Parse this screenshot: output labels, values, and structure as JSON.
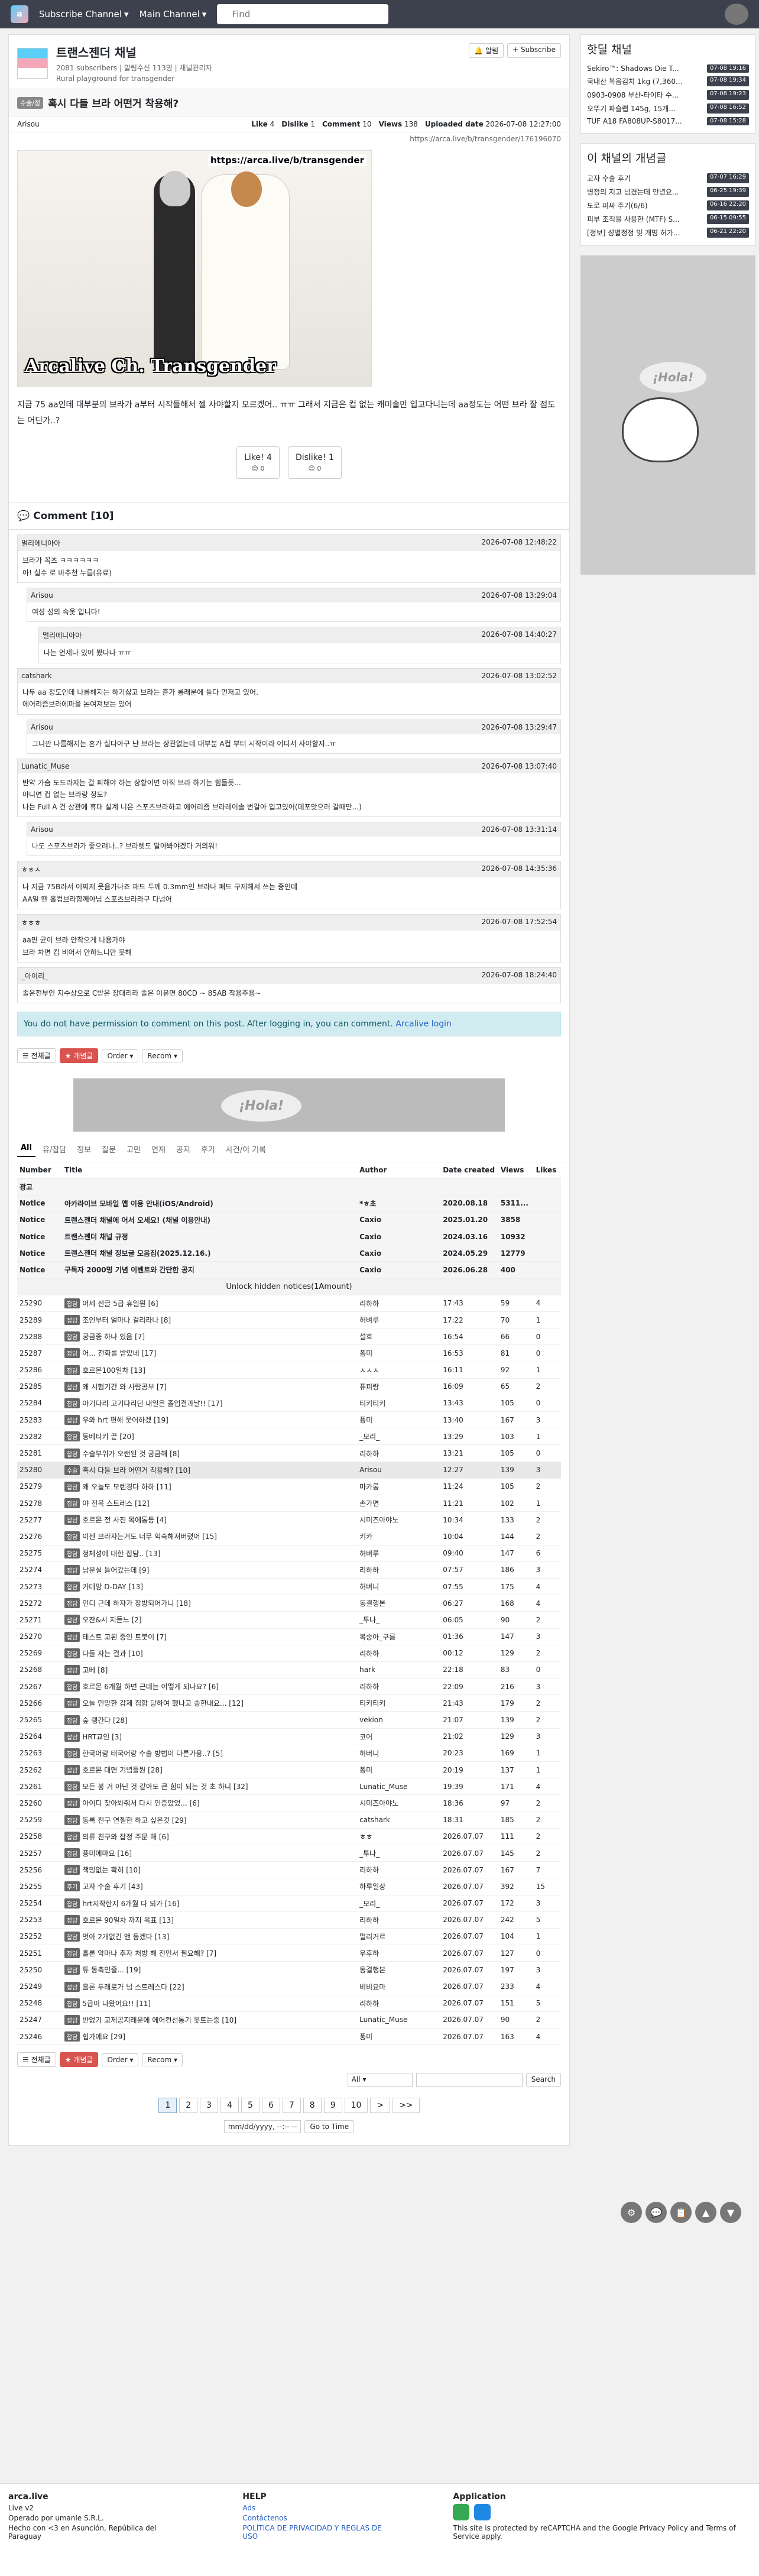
{
  "nav": {
    "subscribe_label": "Subscribe Channel",
    "main_label": "Main Channel",
    "search_placeholder": "Find"
  },
  "board": {
    "title": "트랜스젠더 채널",
    "subscribers": "2081 subscribers",
    "meta_extra": "알림수신 113명",
    "manager": "| 채널관리자",
    "desc": "Rural playground for transgender",
    "notify_label": "알림",
    "subscribe_label": "+ Subscribe"
  },
  "article": {
    "category": "수술/정",
    "title": "혹시 다들 브라 어떤거 착용해?",
    "author": "Arisou",
    "like_label": "Like",
    "like_count": "4",
    "dislike_label": "Dislike",
    "dislike_count": "1",
    "comment_label": "Comment",
    "comment_count": "10",
    "views_label": "Views",
    "views_count": "138",
    "uploaded_label": "Uploaded date",
    "uploaded_date": "2026-07-08 12:27:00",
    "link": "https://arca.live/b/transgender/176196070",
    "image_tag": "https://arca.live/b/transgender",
    "image_caption": "Arcalive Ch. Transgender",
    "body": "지금 75 aa인데 대부분의 브라가 a부터 시작들해서 젤 사야할지 모르겠어.. ㅠㅠ 그래서 지금은 컵 없는 캐미솔만 입고다니는데 aa정도는 어떤 브라 잘 점도는 어딘가..?",
    "vote_like": "Like! 4",
    "vote_like_sub": "😊 0",
    "vote_dislike": "Dislike! 1",
    "vote_dislike_sub": "😊 0"
  },
  "comments_section": {
    "title": "Comment [10]",
    "items": [
      {
        "author": "멀리에니아아",
        "date": "2026-07-08 12:48:22",
        "body": "브라가 꼭츠 ㅋㅋㅋㅋㅋㅋ\n아! 실수 로 바추천 누름(유료)"
      },
      {
        "author": "Arisou",
        "date": "2026-07-08 13:29:04",
        "body": "여성 성의 속옷 입니다!"
      },
      {
        "author": "멀리에니아아",
        "date": "2026-07-08 14:40:27",
        "body": "나는 언제나 있어 봤다나 ㅠㅠ"
      },
      {
        "author": "catshark",
        "date": "2026-07-08 13:02:52",
        "body": "나두 aa 정도인데 나름해지는 하기싫고 브라는 흔가 롱래분에 들다 먼저고 있어.\n에어리즘브라에파을 논여져보는 있어"
      },
      {
        "author": "Arisou",
        "date": "2026-07-08 13:29:47",
        "body": "그니깐 나름해지는 흔가 실다아구 난 브라는 상관없는데 대부분 A컵 부터 시작이라 어디서 사야할지..ㅠ"
      },
      {
        "author": "Lunatic_Muse",
        "date": "2026-07-08 13:07:40",
        "body": "반약 가슴 도드라지는 걸 피해야 하는 상황이면 아직 브라 하기는 힘들듯...\n아니면 컵 없는 브라랑 정도?\n나는 Full A 건 상관에 휴대 설계 니은 스포츠브라하고 에어리즘 브라레이솔 번갈아 입고있어(데포앗으러 갈때만...)"
      },
      {
        "author": "Arisou",
        "date": "2026-07-08 13:31:14",
        "body": "나도 스포츠브라가 좋으려나..? 브라렛도 알아봐야겠다 거의워!"
      },
      {
        "author": "ㅎㅎㅅ",
        "date": "2026-07-08 14:35:36",
        "body": "나 지금 75B라서 어찌저 웃음가나죠 패드 두께 0.3mm인 브라나 패드 구제해서 쓰는 중인데\nAA일 땐 홀컵브라함께아님 스포츠브라라구 다넘어"
      },
      {
        "author": "ㅎㅎㅎ",
        "date": "2026-07-08 17:52:54",
        "body": "aa면 균이 브라 안착으게 나용가야\n브라 차면 컵 비어서 안하느니만 못해"
      },
      {
        "author": "_아이리_",
        "date": "2026-07-08 18:24:40",
        "body": "졸은전부인 지수상으로 C받은 장대리라 졸은 이유면 80CD ~ 85AB 착용주용~"
      }
    ]
  },
  "no_permission": "You do not have permission to comment on this post. After logging in, you can comment.",
  "login_link": "Arcalive login",
  "tools": {
    "all_label": "전체글",
    "best_label": "개념글",
    "order_label": "Order",
    "recom_label": "Recom"
  },
  "ad_text": "¡Hola!",
  "categories": [
    "All",
    "유/잡담",
    "정보",
    "질문",
    "고민",
    "연재",
    "공지",
    "후기",
    "사건/이 기록"
  ],
  "table": {
    "headers": {
      "number": "Number",
      "title": "Title",
      "author": "Author",
      "date": "Date created",
      "views": "Views",
      "likes": "Likes"
    },
    "ad_row": "광고",
    "notices": [
      {
        "no": "Notice",
        "title": "아카라이브 모바일 앱 이용 안내(iOS/Android)",
        "author": "*ㅎ초",
        "date": "2020.08.18",
        "views": "5311...",
        "likes": ""
      },
      {
        "no": "Notice",
        "title": "트랜스젠더 채널에 어서 오세요! (채널 이용안내)",
        "author": "Caxio",
        "date": "2025.01.20",
        "views": "3858",
        "likes": ""
      },
      {
        "no": "Notice",
        "title": "트랜스젠더 채널 규정",
        "author": "Caxio",
        "date": "2024.03.16",
        "views": "10932",
        "likes": ""
      },
      {
        "no": "Notice",
        "title": "트랜스젠더 채널 정보글 모음집(2025.12.16.)",
        "author": "Caxio",
        "date": "2024.05.29",
        "views": "12779",
        "likes": ""
      },
      {
        "no": "Notice",
        "title": "구독자 2000명 기념 이벤트와 간단한 공지",
        "author": "Caxio",
        "date": "2026.06.28",
        "views": "400",
        "likes": ""
      }
    ],
    "unlock_label": "Unlock hidden notices(1Amount)",
    "rows": [
      {
        "no": "25290",
        "cat": "잡담",
        "title": "어제 선글 5급 휴일뭔 [6]",
        "author": "리하하",
        "date": "17:43",
        "views": "59",
        "likes": "4"
      },
      {
        "no": "25289",
        "cat": "잡담",
        "title": "조인부터 얼마나 걸리라나 [8]",
        "author": "허벼루",
        "date": "17:22",
        "views": "70",
        "likes": "1"
      },
      {
        "no": "25288",
        "cat": "잡담",
        "title": "궁금증 하나 있음 [7]",
        "author": "설호",
        "date": "16:54",
        "views": "66",
        "likes": "0"
      },
      {
        "no": "25287",
        "cat": "잡담",
        "title": "어... 전화를 받았네 [17]",
        "author": "퐁미",
        "date": "16:53",
        "views": "81",
        "likes": "0"
      },
      {
        "no": "25286",
        "cat": "잡담",
        "title": "호르몬100일차 [13]",
        "author": "ㅅㅅㅅ",
        "date": "16:11",
        "views": "92",
        "likes": "1"
      },
      {
        "no": "25285",
        "cat": "잡담",
        "title": "왜 시험기간 와 사람공부 [7]",
        "author": "퓨피랑",
        "date": "16:09",
        "views": "65",
        "likes": "2"
      },
      {
        "no": "25284",
        "cat": "잡담",
        "title": "아기다리 고기다리던 내일은 졸업결과날!! [17]",
        "author": "티키티키",
        "date": "13:43",
        "views": "105",
        "likes": "0"
      },
      {
        "no": "25283",
        "cat": "잡담",
        "title": "우와 hrt 편해 웃어하겠 [19]",
        "author": "퓽미",
        "date": "13:40",
        "views": "167",
        "likes": "3"
      },
      {
        "no": "25282",
        "cat": "잡담",
        "title": "동베티키 끝 [20]",
        "author": "_모리_",
        "date": "13:29",
        "views": "103",
        "likes": "1"
      },
      {
        "no": "25281",
        "cat": "잡담",
        "title": "수술부위가 오랜된 것 궁금해 [8]",
        "author": "리하하",
        "date": "13:21",
        "views": "105",
        "likes": "0"
      },
      {
        "no": "25280",
        "cat": "수술",
        "title": "혹시 다들 브라 어떤거 착용해? [10]",
        "author": "Arisou",
        "date": "12:27",
        "views": "139",
        "likes": "3"
      },
      {
        "no": "25279",
        "cat": "잡담",
        "title": "왜 오늘도 모렌경다 하하 [11]",
        "author": "마카롱",
        "date": "11:24",
        "views": "105",
        "likes": "2"
      },
      {
        "no": "25278",
        "cat": "잡담",
        "title": "야 전목 스트레스 [12]",
        "author": "손가면",
        "date": "11:21",
        "views": "102",
        "likes": "1"
      },
      {
        "no": "25277",
        "cat": "잡담",
        "title": "호르몬 전 사진 목에통등 [4]",
        "author": "시미즈아야노",
        "date": "10:34",
        "views": "133",
        "likes": "2"
      },
      {
        "no": "25276",
        "cat": "잡담",
        "title": "이젠 브라자는거도 너무 익숙해져버렸어 [15]",
        "author": "키카",
        "date": "10:04",
        "views": "144",
        "likes": "2"
      },
      {
        "no": "25275",
        "cat": "잡담",
        "title": "정체성에 대한 잡담.. [13]",
        "author": "허벼루",
        "date": "09:40",
        "views": "147",
        "likes": "6"
      },
      {
        "no": "25274",
        "cat": "잡담",
        "title": "남문실 들어갔는데 [9]",
        "author": "리하하",
        "date": "07:57",
        "views": "186",
        "likes": "3"
      },
      {
        "no": "25273",
        "cat": "잡담",
        "title": "카데망 D-DAY [13]",
        "author": "허벼니",
        "date": "07:55",
        "views": "175",
        "likes": "4"
      },
      {
        "no": "25272",
        "cat": "잡담",
        "title": "인디 근데 하자가 장방되어가니 [18]",
        "author": "동결행본",
        "date": "06:27",
        "views": "168",
        "likes": "4"
      },
      {
        "no": "25271",
        "cat": "잡담",
        "title": "오잔&시 지듣느 [2]",
        "author": "_투나_",
        "date": "06:05",
        "views": "90",
        "likes": "2"
      },
      {
        "no": "25270",
        "cat": "잡담",
        "title": "테스트 고된 중인 트붓이 [7]",
        "author": "복숭아_구름",
        "date": "01:36",
        "views": "147",
        "likes": "3"
      },
      {
        "no": "25269",
        "cat": "잡담",
        "title": "다들 자는 결과 [10]",
        "author": "리하하",
        "date": "00:12",
        "views": "129",
        "likes": "2"
      },
      {
        "no": "25268",
        "cat": "잡담",
        "title": "고베 [8]",
        "author": "hark",
        "date": "22:18",
        "views": "83",
        "likes": "0"
      },
      {
        "no": "25267",
        "cat": "잡담",
        "title": "호르몬 6개월 하면 근데는 어떻게 되나요? [6]",
        "author": "리하하",
        "date": "22:09",
        "views": "216",
        "likes": "3"
      },
      {
        "no": "25266",
        "cat": "잡담",
        "title": "오늘 민망한 감제 집합 당하여 했나고 송한내요... [12]",
        "author": "티키티키",
        "date": "21:43",
        "views": "179",
        "likes": "2"
      },
      {
        "no": "25265",
        "cat": "잡담",
        "title": "숲 랭간다 [28]",
        "author": "vekion",
        "date": "21:07",
        "views": "139",
        "likes": "2"
      },
      {
        "no": "25264",
        "cat": "잡담",
        "title": "HRT교인 [3]",
        "author": "코어",
        "date": "21:02",
        "views": "129",
        "likes": "3"
      },
      {
        "no": "25263",
        "cat": "잡담",
        "title": "한국어랑 태국어랑 수술 방법이 다른가용..? [5]",
        "author": "허버니",
        "date": "20:23",
        "views": "169",
        "likes": "1"
      },
      {
        "no": "25262",
        "cat": "잡담",
        "title": "호르몬 대면 기념틀뭔 [28]",
        "author": "퐁미",
        "date": "20:19",
        "views": "137",
        "likes": "1"
      },
      {
        "no": "25261",
        "cat": "잡담",
        "title": "모든 봉 거 아닌 것 같아도 큰 힘이 되는 것 초 하니 [32]",
        "author": "Lunatic_Muse",
        "date": "19:39",
        "views": "171",
        "likes": "4"
      },
      {
        "no": "25260",
        "cat": "잡담",
        "title": "아이디 찾아봐줘서 다시 인증았었... [6]",
        "author": "시미즈아야노",
        "date": "18:36",
        "views": "97",
        "likes": "2"
      },
      {
        "no": "25259",
        "cat": "잡담",
        "title": "동록 친구 연젤한 하고 싶은것 [29]",
        "author": "catshark",
        "date": "18:31",
        "views": "185",
        "likes": "2"
      },
      {
        "no": "25258",
        "cat": "잡담",
        "title": "의류 친구와 잡정 주문 해 [6]",
        "author": "ㅎㅎ",
        "date": "2026.07.07",
        "views": "111",
        "likes": "2"
      },
      {
        "no": "25257",
        "cat": "잡담",
        "title": "퓽미에마요 [16]",
        "author": "_투나_",
        "date": "2026.07.07",
        "views": "145",
        "likes": "2"
      },
      {
        "no": "25256",
        "cat": "잡담",
        "title": "책밍없는 확히 [10]",
        "author": "리하하",
        "date": "2026.07.07",
        "views": "167",
        "likes": "7"
      },
      {
        "no": "25255",
        "cat": "후기",
        "title": "고자 수술 후기 [43]",
        "author": "하루일상",
        "date": "2026.07.07",
        "views": "392",
        "likes": "15"
      },
      {
        "no": "25254",
        "cat": "잡담",
        "title": "hrt지작한지 6개월 다 되가 [16]",
        "author": "_모리_",
        "date": "2026.07.07",
        "views": "172",
        "likes": "3"
      },
      {
        "no": "25253",
        "cat": "잡담",
        "title": "호르몬 90일차 까지 목표 [13]",
        "author": "리하하",
        "date": "2026.07.07",
        "views": "242",
        "likes": "5"
      },
      {
        "no": "25252",
        "cat": "잡담",
        "title": "멋아 2개없긴 앤 동겠다 [13]",
        "author": "멀리거르",
        "date": "2026.07.07",
        "views": "104",
        "likes": "1"
      },
      {
        "no": "25251",
        "cat": "잡담",
        "title": "흘론 악마나 추자 처방 해 전인서 필요해? [7]",
        "author": "우후하",
        "date": "2026.07.07",
        "views": "127",
        "likes": "0"
      },
      {
        "no": "25250",
        "cat": "잡담",
        "title": "튜 동축인줄... [19]",
        "author": "동결행본",
        "date": "2026.07.07",
        "views": "197",
        "likes": "3"
      },
      {
        "no": "25249",
        "cat": "잡담",
        "title": "흘론 두래로가 넘 스트레스다 [22]",
        "author": "비비요마",
        "date": "2026.07.07",
        "views": "233",
        "likes": "4"
      },
      {
        "no": "25248",
        "cat": "잡담",
        "title": "5급이 나왔어요!! [11]",
        "author": "리하하",
        "date": "2026.07.07",
        "views": "151",
        "likes": "5"
      },
      {
        "no": "25247",
        "cat": "잡담",
        "title": "반없기 고제공지래문에 에어컨선통기 못트는중 [10]",
        "author": "Lunatic_Muse",
        "date": "2026.07.07",
        "views": "90",
        "likes": "2"
      },
      {
        "no": "25246",
        "cat": "잡담",
        "title": "힙가에요 [29]",
        "author": "퐁미",
        "date": "2026.07.07",
        "views": "163",
        "likes": "4"
      }
    ]
  },
  "pager": [
    "1",
    "2",
    "3",
    "4",
    "5",
    "6",
    "7",
    "8",
    "9",
    "10",
    ">",
    ">>"
  ],
  "search": {
    "scope": "All",
    "button": "Search"
  },
  "date_search": {
    "placeholder": "mm/dd/yyyy, --:-- --",
    "button": "Go to Time"
  },
  "sidebar": {
    "hot_title": "핫딜 채널",
    "hot": [
      {
        "title": "Sekiro™: Shadows Die T...",
        "time": "07-08 19:16"
      },
      {
        "title": "국내산 복음김치 1kg (7,360...",
        "time": "07-08 19:34"
      },
      {
        "title": "0903-0908 부산-타이타 수...",
        "time": "07-08 19:23"
      },
      {
        "title": "오뚜기 파슬랩 145g, 15개...",
        "time": "07-08 16:52"
      },
      {
        "title": "TUF A18 FA808UP-S8017...",
        "time": "07-08 15:28"
      }
    ],
    "best_title": "이 채널의 개념글",
    "best": [
      {
        "title": "고자 수술 후기",
        "time": "07-07 16:29"
      },
      {
        "title": "병정의 지고 넘겼는데 안녕요...",
        "time": "06-25 19:39"
      },
      {
        "title": "도로 퍼싸 주기(6/6)",
        "time": "06-16 22:20"
      },
      {
        "title": "피부 조직을 사용한 (MTF) S...",
        "time": "06-15 09:55"
      },
      {
        "title": "[정보] 성별정정 및 개명 허가...",
        "time": "06-21 22:20"
      }
    ],
    "ad_text": "¡Hola!"
  },
  "floats": [
    "⚙",
    "💬",
    "📋",
    "▲",
    "▼"
  ],
  "footer": {
    "brand": "arca.live",
    "brand_version": "Live v2",
    "operator": "Operado por umanle S.R.L.",
    "made": "Hecho con <3 en Asunción, República del Paraguay",
    "help_title": "HELP",
    "help_links": [
      "Ads",
      "Contáctenos",
      "POLÍTICA DE PRIVACIDAD Y REGLAS DE USO"
    ],
    "app_title": "Application",
    "app_note": "This site is protected by reCAPTCHA and the Google Privacy Policy and Terms of Service apply."
  }
}
